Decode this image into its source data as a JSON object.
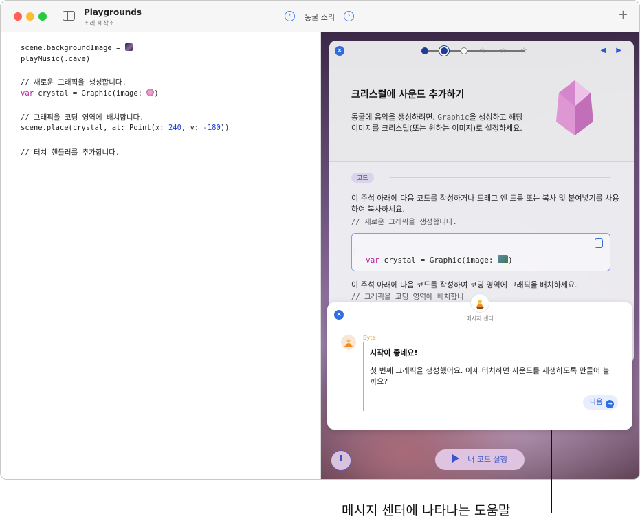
{
  "window": {
    "app_title": "Playgrounds",
    "app_subtitle": "소리 제작소",
    "page_name": "동굴 소리",
    "nav_prev": "‹",
    "nav_next": "›",
    "add": "+"
  },
  "editor": {
    "lines": {
      "l1": "scene.backgroundImage = ",
      "l2": "playMusic(.cave)",
      "l3": "// 새로운 그래픽을 생성합니다.",
      "l4_kw": "var",
      "l4": " crystal = Graphic(image: ",
      "l4_end": ")",
      "l5": "// 그래픽을 코딩 영역에 배치합니다.",
      "l6a": "scene.place(crystal, at: Point(x: ",
      "l6_x": "240",
      "l6b": ", y: ",
      "l6_y": "-180",
      "l6c": "))",
      "l7": "// 터치 핸들러를 추가합니다."
    }
  },
  "guide": {
    "close": "×",
    "arrows": "◀ ▶",
    "title": "크리스털에 사운드 추가하기",
    "intro_a": "동굴에 음악을 생성하려면, ",
    "intro_mono": "Graphic",
    "intro_b": "을 생성하고 해당 이미지를 크리스털(또는 원하는 이미지)로 설정하세요.",
    "code_tag": "코드",
    "instruction1": "이 주석 아래에 다음 코드를 작성하거나 드래그 앤 드롭 또는 복사 및 붙여넣기를 사용하여 복사하세요.",
    "comment1": "// 새로운 그래픽을 생성합니다.",
    "snippet_kw": "var",
    "snippet_code": " crystal = Graphic(image: ",
    "snippet_end": ")",
    "instruction2": "이 주석 아래에 다음 코드를 작성하여 코딩 영역에 그래픽을 배치하세요.",
    "comment2": "// 그래픽을 코딩 영역에 배치합니"
  },
  "message_center": {
    "header": "메시지 센터",
    "close": "×",
    "sender": "Byte",
    "headline": "시작이 좋네요!",
    "body": "첫 번째 그래픽을 생성했어요. 이제 터치하면 사운드를 재생하도록 만들어 볼까요?",
    "next_label": "다음",
    "next_icon": "→"
  },
  "controls": {
    "run_label": "내 코드 실행"
  },
  "callout": {
    "text": "메시지 센터에 나타나는 도움말"
  }
}
